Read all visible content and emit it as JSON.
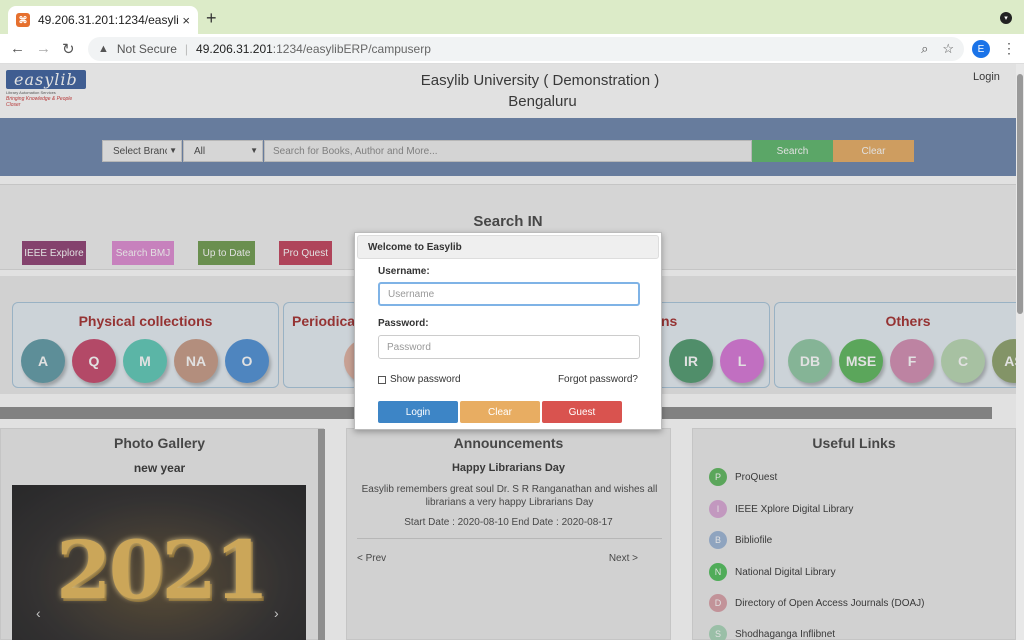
{
  "browser": {
    "tab_title": "49.206.31.201:1234/easylibERP/campuserp",
    "favicon": "xampp-icon",
    "new_tab": "+",
    "close": "×",
    "not_secure": "Not Secure",
    "url_host": "49.206.31.201",
    "url_path": ":1234/easylibERP/campuserp",
    "profile_initial": "E"
  },
  "header": {
    "logo_text": "easylib",
    "logo_sub": "Library Automation Services",
    "logo_tag": "Bringing Knowledge & People Closer",
    "university": "Easylib University ( Demonstration )",
    "city": "Bengaluru",
    "login": "Login"
  },
  "search": {
    "branch": "Select Branch",
    "category": "All",
    "placeholder": "Search for Books, Author and More...",
    "search_btn": "Search",
    "clear_btn": "Clear"
  },
  "search_in": {
    "title": "Search IN",
    "items": [
      {
        "label": "IEEE Explore",
        "color": "#8e3d72"
      },
      {
        "label": "Search BMJ",
        "color": "#e08ad3"
      },
      {
        "label": "Up to Date",
        "color": "#6e9b4e"
      },
      {
        "label": "Pro Quest",
        "color": "#c2405b"
      }
    ]
  },
  "collections": {
    "physical": {
      "title": "Physical collections",
      "items": [
        {
          "label": "A",
          "color": "#5e9aa6"
        },
        {
          "label": "Q",
          "color": "#c7466b"
        },
        {
          "label": "M",
          "color": "#5ccab8"
        },
        {
          "label": "NA",
          "color": "#c79a85"
        },
        {
          "label": "O",
          "color": "#4c8fd6"
        }
      ]
    },
    "periodicals": {
      "title": "Periodica"
    },
    "middle": {
      "title": "ns",
      "items": [
        {
          "label": "IR",
          "color": "#4f9a6e"
        },
        {
          "label": "L",
          "color": "#d875d8"
        }
      ]
    },
    "others": {
      "title": "Others",
      "items": [
        {
          "label": "DB",
          "color": "#8fc9a4"
        },
        {
          "label": "MSE",
          "color": "#5cb85c"
        },
        {
          "label": "F",
          "color": "#d48db2"
        },
        {
          "label": "C",
          "color": "#b9d8b2"
        },
        {
          "label": "AS",
          "color": "#8da26b"
        }
      ]
    }
  },
  "gallery": {
    "title": "Photo Gallery",
    "subtitle": "new year",
    "year": "2021",
    "prev": "‹",
    "next": "›"
  },
  "announcements": {
    "title": "Announcements",
    "headline": "Happy Librarians Day",
    "body": "Easylib remembers great soul Dr. S R Ranganathan and wishes all librarians a very happy Librarians Day",
    "dates": "Start Date : 2020-08-10 End Date : 2020-08-17",
    "prev": "< Prev",
    "next": "Next >"
  },
  "links": {
    "title": "Useful Links",
    "items": [
      {
        "initial": "P",
        "label": "ProQuest",
        "color": "#5cb85c"
      },
      {
        "initial": "I",
        "label": "IEEE Xplore Digital Library",
        "color": "#d9a7d6"
      },
      {
        "initial": "B",
        "label": "Bibliofile",
        "color": "#9cb5d6"
      },
      {
        "initial": "N",
        "label": "National Digital Library",
        "color": "#4fbf5a"
      },
      {
        "initial": "D",
        "label": "Directory of Open Access Journals (DOAJ)",
        "color": "#d9a0a8"
      },
      {
        "initial": "S",
        "label": "Shodhaganga Inflibnet",
        "color": "#a9d6b9"
      }
    ]
  },
  "modal": {
    "title": "Welcome to Easylib",
    "username_label": "Username:",
    "username_placeholder": "Username",
    "password_label": "Password:",
    "password_placeholder": "Password",
    "show_password": "Show password",
    "forgot": "Forgot password?",
    "login_btn": "Login",
    "clear_btn": "Clear",
    "guest_btn": "Guest",
    "login_color": "#3d85c6",
    "clear_color": "#e8ad62",
    "guest_color": "#d9534f"
  }
}
